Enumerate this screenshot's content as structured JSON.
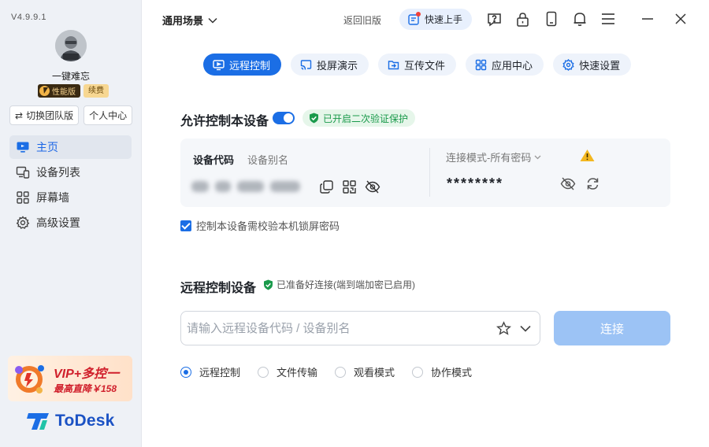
{
  "app": {
    "version": "V4.9.9.1",
    "brand": "ToDesk",
    "colors": {
      "accent": "#1b6ee5",
      "sidebar_bg": "#eef1f6",
      "success": "#1a9a4b",
      "promo_red": "#d0202c"
    }
  },
  "profile": {
    "username": "一键难忘",
    "badge_edition": "性能版",
    "badge_renew": "续费",
    "switch_team": "切换团队版",
    "personal_center": "个人中心"
  },
  "sidebar": {
    "items": [
      {
        "label": "主页",
        "icon": "monitor-icon",
        "active": true
      },
      {
        "label": "设备列表",
        "icon": "devices-icon",
        "active": false
      },
      {
        "label": "屏幕墙",
        "icon": "grid-icon",
        "active": false
      },
      {
        "label": "高级设置",
        "icon": "gear-icon",
        "active": false
      }
    ]
  },
  "promo": {
    "title": "VIP+多控一",
    "subtitle": "最高直降￥158"
  },
  "header": {
    "scene": "通用场景",
    "old_version": "返回旧版",
    "quickstart": "快速上手",
    "icons": [
      "help-icon",
      "lock-icon",
      "phone-icon",
      "bell-icon",
      "menu-icon"
    ]
  },
  "tabs": [
    {
      "label": "远程控制",
      "icon": "remote-icon",
      "active": true
    },
    {
      "label": "投屏演示",
      "icon": "cast-icon",
      "active": false
    },
    {
      "label": "互传文件",
      "icon": "folder-icon",
      "active": false
    },
    {
      "label": "应用中心",
      "icon": "apps-icon",
      "active": false
    },
    {
      "label": "快速设置",
      "icon": "settings-icon",
      "active": false
    }
  ],
  "allow_control": {
    "title": "允许控制本设备",
    "toggle_on": true,
    "verify_badge": "已开启二次验证保护",
    "code_label": "设备代码",
    "alias_label": "设备别名",
    "mode_label": "连接模式-所有密码",
    "password_masked": "********",
    "checkbox_label": "控制本设备需校验本机锁屏密码",
    "checkbox_checked": true
  },
  "remote_control": {
    "title": "远程控制设备",
    "ready_text": "已准备好连接(端到端加密已启用)",
    "input_placeholder": "请输入远程设备代码 / 设备别名",
    "input_value": "",
    "connect_label": "连接",
    "modes": [
      {
        "label": "远程控制",
        "checked": true
      },
      {
        "label": "文件传输",
        "checked": false
      },
      {
        "label": "观看模式",
        "checked": false
      },
      {
        "label": "协作模式",
        "checked": false
      }
    ]
  }
}
